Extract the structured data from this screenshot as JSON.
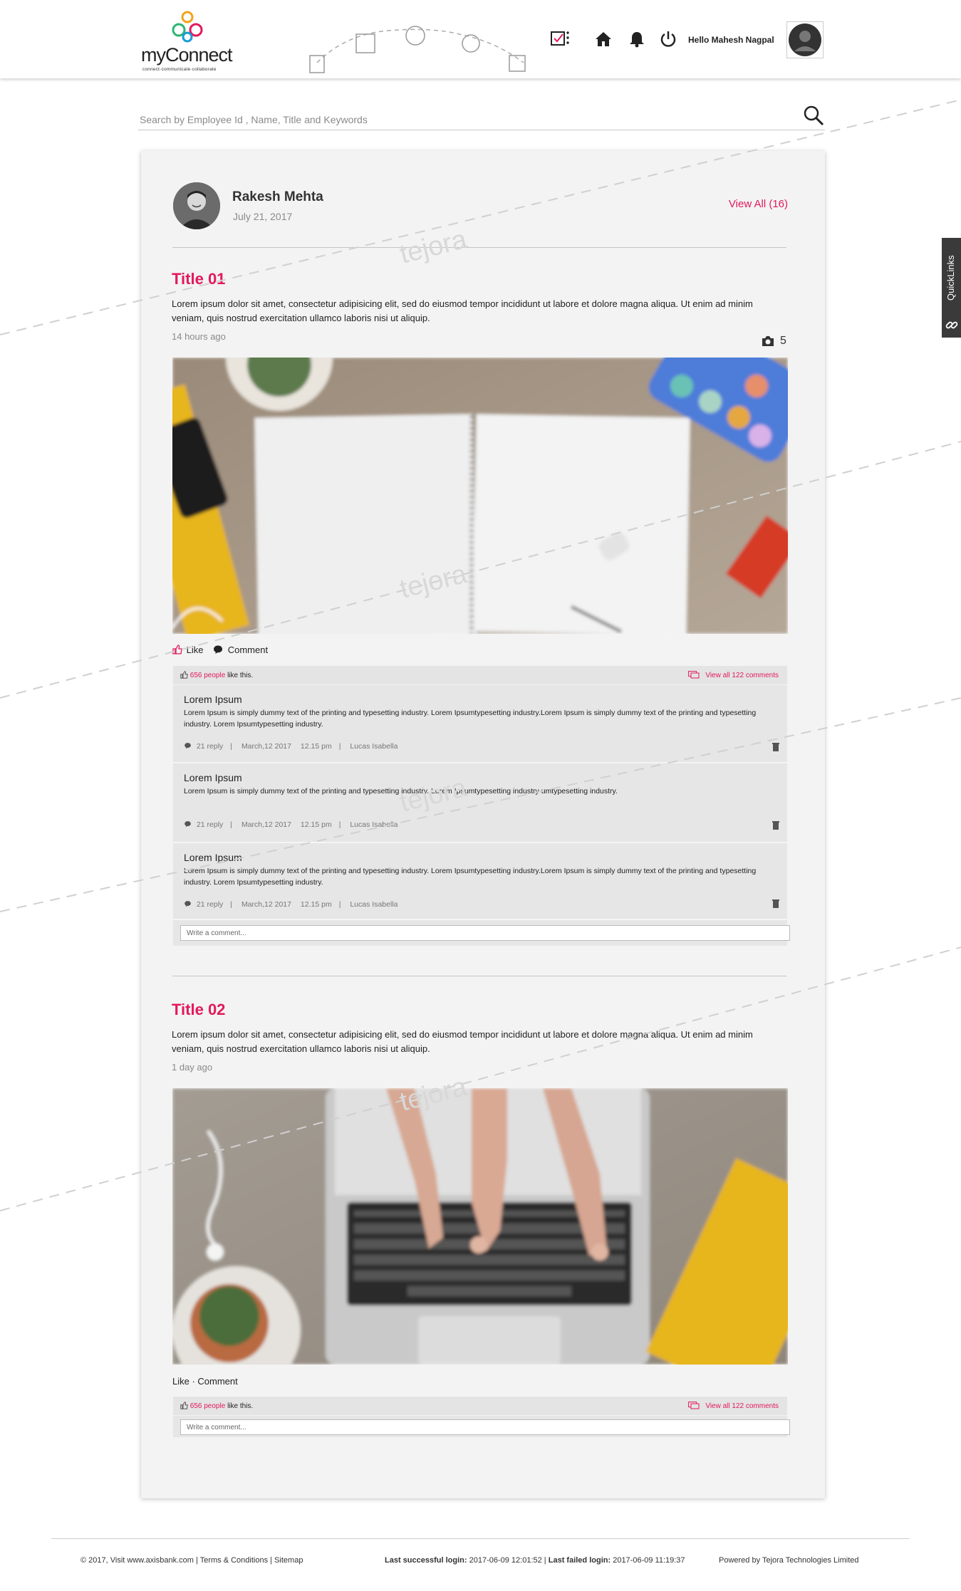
{
  "header": {
    "logo_text": "myConnect",
    "logo_tagline": "connect·communicate·collaborate",
    "greeting": "Hello Mahesh Nagpal"
  },
  "search": {
    "placeholder": "Search by Employee Id , Name, Title and Keywords"
  },
  "quicklinks": {
    "label": "QuickLinks"
  },
  "author": {
    "name": "Rakesh Mehta",
    "date": "July 21, 2017",
    "view_all": "View All (16)"
  },
  "posts": [
    {
      "title": "Title 01",
      "body": "Lorem ipsum dolor sit amet, consectetur adipisicing elit, sed do eiusmod tempor incididunt ut labore et dolore magna aliqua. Ut enim ad minim veniam, quis nostrud exercitation ullamco laboris nisi ut aliquip.",
      "time": "14 hours ago",
      "photo_count": "5",
      "like_label": "Like",
      "comment_label": "Comment",
      "like_count": "656 people",
      "like_suffix": "like this.",
      "view_comments": "View all 122 comments",
      "comments": [
        {
          "title": "Lorem Ipsum",
          "text": "Lorem Ipsum is simply dummy text of the printing and typesetting industry. Lorem Ipsumtypesetting industry.Lorem Ipsum is simply dummy text of the printing and typesetting industry. Lorem Ipsumtypesetting industry.",
          "replies": "21 reply",
          "date": "March,12 2017",
          "time": "12.15 pm",
          "author": "Lucas Isabella"
        },
        {
          "title": "Lorem Ipsum",
          "text": "Lorem Ipsum is simply dummy text of the printing and typesetting industry. Lorem Ipsumtypesetting industry umtypesetting industry.",
          "replies": "21 reply",
          "date": "March,12 2017",
          "time": "12.15 pm",
          "author": "Lucas Isabella"
        },
        {
          "title": "Lorem Ipsum",
          "text": "Lorem Ipsum is simply dummy text of the printing and typesetting industry. Lorem Ipsumtypesetting industry.Lorem Ipsum is simply dummy text of the printing and typesetting industry. Lorem Ipsumtypesetting industry.",
          "replies": "21 reply",
          "date": "March,12 2017",
          "time": "12.15 pm",
          "author": "Lucas Isabella"
        }
      ],
      "comment_placeholder": "Write a comment..."
    },
    {
      "title": "Title 02",
      "body": "Lorem ipsum dolor sit amet, consectetur adipisicing elit, sed do eiusmod tempor incididunt ut labore et dolore magna aliqua. Ut enim ad minim veniam, quis nostrud exercitation ullamco laboris nisi ut aliquip.",
      "time": "1 day ago",
      "actions_text": "Like · Comment",
      "like_count": "656 people",
      "like_suffix": "like this.",
      "view_comments": "View all 122 comments",
      "comment_placeholder": "Write a comment..."
    }
  ],
  "footer": {
    "copyright": "© 2017, Visit",
    "site": "www.axisbank.com",
    "terms": "Terms & Conditions",
    "sitemap": "Sitemap",
    "last_login_label": "Last successful login:",
    "last_login": "2017-06-09 12:01:52",
    "last_failed_label": "Last failed login:",
    "last_failed": "2017-06-09 11:19:37",
    "powered_by": "Powered by",
    "company": "Tejora Technologies Limited"
  },
  "watermark": "tejora",
  "colors": {
    "accent": "#e2195b",
    "card": "#f3f3f3",
    "dark": "#3a3a3a"
  }
}
